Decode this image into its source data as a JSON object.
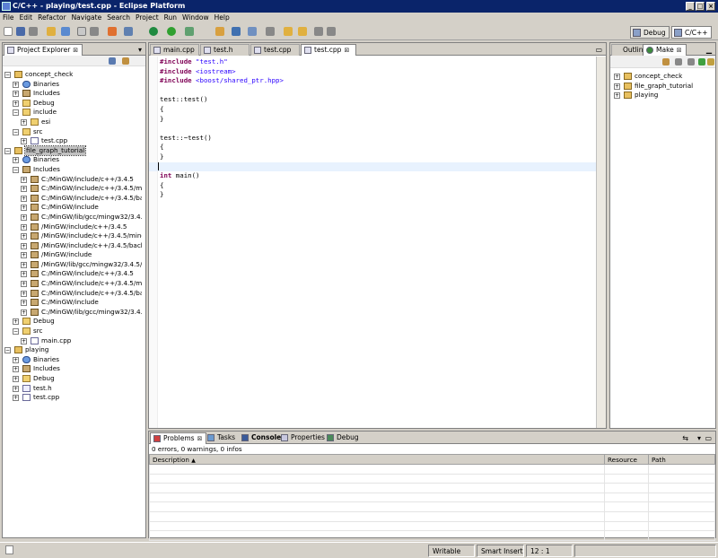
{
  "window": {
    "title": "C/C++ - playing/test.cpp - Eclipse Platform"
  },
  "menu": [
    "File",
    "Edit",
    "Refactor",
    "Navigate",
    "Search",
    "Project",
    "Run",
    "Window",
    "Help"
  ],
  "perspectives": {
    "debug": "Debug",
    "cpp": "C/C++"
  },
  "project_explorer": {
    "tab": "Project Explorer",
    "tree": [
      {
        "label": "concept_check",
        "depth": 0,
        "icon": "project-icon",
        "exp": "-"
      },
      {
        "label": "Binaries",
        "depth": 1,
        "icon": "binaries-icon",
        "exp": "+"
      },
      {
        "label": "Includes",
        "depth": 1,
        "icon": "includes-icon",
        "exp": "+"
      },
      {
        "label": "Debug",
        "depth": 1,
        "icon": "folder-icon",
        "exp": "+"
      },
      {
        "label": "include",
        "depth": 1,
        "icon": "folder-icon",
        "exp": "-"
      },
      {
        "label": "esi",
        "depth": 2,
        "icon": "folder-icon",
        "exp": "+"
      },
      {
        "label": "src",
        "depth": 1,
        "icon": "folder-icon",
        "exp": "-"
      },
      {
        "label": "test.cpp",
        "depth": 2,
        "icon": "cpp-file-icon",
        "exp": "+"
      },
      {
        "label": "file_graph_tutorial",
        "depth": 0,
        "icon": "project-icon",
        "exp": "-",
        "selected": true
      },
      {
        "label": "Binaries",
        "depth": 1,
        "icon": "binaries-icon",
        "exp": "+"
      },
      {
        "label": "Includes",
        "depth": 1,
        "icon": "includes-icon",
        "exp": "-"
      },
      {
        "label": "C:/MinGW/include/c++/3.4.5",
        "depth": 2,
        "icon": "include-path-icon",
        "exp": "+"
      },
      {
        "label": "C:/MinGW/include/c++/3.4.5/ming",
        "depth": 2,
        "icon": "include-path-icon",
        "exp": "+"
      },
      {
        "label": "C:/MinGW/include/c++/3.4.5/back",
        "depth": 2,
        "icon": "include-path-icon",
        "exp": "+"
      },
      {
        "label": "C:/MinGW/include",
        "depth": 2,
        "icon": "include-path-icon",
        "exp": "+"
      },
      {
        "label": "C:/MinGW/lib/gcc/mingw32/3.4.5/i",
        "depth": 2,
        "icon": "include-path-icon",
        "exp": "+"
      },
      {
        "label": "/MinGW/include/c++/3.4.5",
        "depth": 2,
        "icon": "include-path-icon",
        "exp": "+"
      },
      {
        "label": "/MinGW/include/c++/3.4.5/mingw3",
        "depth": 2,
        "icon": "include-path-icon",
        "exp": "+"
      },
      {
        "label": "/MinGW/include/c++/3.4.5/backwa",
        "depth": 2,
        "icon": "include-path-icon",
        "exp": "+"
      },
      {
        "label": "/MinGW/include",
        "depth": 2,
        "icon": "include-path-icon",
        "exp": "+"
      },
      {
        "label": "/MinGW/lib/gcc/mingw32/3.4.5/incl",
        "depth": 2,
        "icon": "include-path-icon",
        "exp": "+"
      },
      {
        "label": "C:/MinGW/include/c++/3.4.5",
        "depth": 2,
        "icon": "include-path-icon",
        "exp": "+"
      },
      {
        "label": "C:/MinGW/include/c++/3.4.5/ming",
        "depth": 2,
        "icon": "include-path-icon",
        "exp": "+"
      },
      {
        "label": "C:/MinGW/include/c++/3.4.5/back",
        "depth": 2,
        "icon": "include-path-icon",
        "exp": "+"
      },
      {
        "label": "C:/MinGW/include",
        "depth": 2,
        "icon": "include-path-icon",
        "exp": "+"
      },
      {
        "label": "C:/MinGW/lib/gcc/mingw32/3.4.5/i",
        "depth": 2,
        "icon": "include-path-icon",
        "exp": "+"
      },
      {
        "label": "Debug",
        "depth": 1,
        "icon": "folder-icon",
        "exp": "+"
      },
      {
        "label": "src",
        "depth": 1,
        "icon": "folder-icon",
        "exp": "-"
      },
      {
        "label": "main.cpp",
        "depth": 2,
        "icon": "cpp-file-icon",
        "exp": "+"
      },
      {
        "label": "playing",
        "depth": 0,
        "icon": "project-icon",
        "exp": "-"
      },
      {
        "label": "Binaries",
        "depth": 1,
        "icon": "binaries-icon",
        "exp": "+"
      },
      {
        "label": "Includes",
        "depth": 1,
        "icon": "includes-icon",
        "exp": "+"
      },
      {
        "label": "Debug",
        "depth": 1,
        "icon": "folder-icon",
        "exp": "+"
      },
      {
        "label": "test.h",
        "depth": 1,
        "icon": "header-file-icon",
        "exp": "+"
      },
      {
        "label": "test.cpp",
        "depth": 1,
        "icon": "cpp-file-icon",
        "exp": "+"
      }
    ]
  },
  "editor": {
    "tabs": [
      "main.cpp",
      "test.h",
      "test.cpp",
      "test.cpp"
    ],
    "active_tab": 3,
    "lines": [
      [
        {
          "t": "#include ",
          "c": "kw"
        },
        {
          "t": "\"test.h\"",
          "c": "str"
        }
      ],
      [
        {
          "t": "#include ",
          "c": "kw"
        },
        {
          "t": "<iostream>",
          "c": "str"
        }
      ],
      [
        {
          "t": "#include ",
          "c": "kw"
        },
        {
          "t": "<boost/shared_ptr.hpp>",
          "c": "str"
        }
      ],
      [],
      [
        {
          "t": "test::test()"
        }
      ],
      [
        {
          "t": "{"
        }
      ],
      [
        {
          "t": "}"
        }
      ],
      [],
      [
        {
          "t": "test::~test()"
        }
      ],
      [
        {
          "t": "{"
        }
      ],
      [
        {
          "t": "}"
        }
      ],
      [
        {
          "t": "",
          "cur": true
        }
      ],
      [
        {
          "t": "int",
          "c": "kw"
        },
        {
          "t": " main()"
        }
      ],
      [
        {
          "t": "{"
        }
      ],
      [
        {
          "t": "}"
        }
      ]
    ]
  },
  "outline": {
    "tabs": [
      "Outlin",
      "Make"
    ],
    "tree": [
      "concept_check",
      "file_graph_tutorial",
      "playing"
    ]
  },
  "bottom": {
    "tabs": [
      "Problems",
      "Tasks",
      "Console",
      "Properties",
      "Debug"
    ],
    "summary": "0 errors, 0 warnings, 0 infos",
    "columns": [
      "Description",
      "Resource",
      "Path"
    ]
  },
  "statusbar": {
    "writable": "Writable",
    "insert": "Smart Insert",
    "position": "12 : 1"
  }
}
